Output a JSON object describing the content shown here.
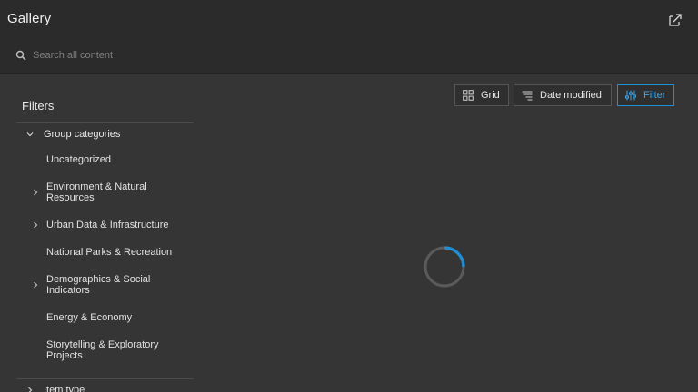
{
  "header": {
    "title": "Gallery",
    "share_icon": "share-export-icon"
  },
  "search": {
    "placeholder": "Search all content",
    "value": ""
  },
  "toolbar": {
    "grid_label": "Grid",
    "sort_label": "Date modified",
    "filter_label": "Filter",
    "accent_color": "#1e8fd6"
  },
  "sidebar": {
    "title": "Filters",
    "group": {
      "label": "Group categories",
      "expanded": true,
      "items": [
        {
          "label": "Uncategorized",
          "has_children": false
        },
        {
          "label": "Environment & Natural\nResources",
          "has_children": true
        },
        {
          "label": "Urban Data & Infrastructure",
          "has_children": true
        },
        {
          "label": "National Parks & Recreation",
          "has_children": false
        },
        {
          "label": "Demographics & Social\nIndicators",
          "has_children": true
        },
        {
          "label": "Energy & Economy",
          "has_children": false
        },
        {
          "label": "Storytelling & Exploratory\nProjects",
          "has_children": false
        }
      ]
    },
    "next_group": {
      "label": "Item type",
      "expanded": false
    }
  },
  "main": {
    "loading": true,
    "spinner_color": "#1e8fd6"
  }
}
